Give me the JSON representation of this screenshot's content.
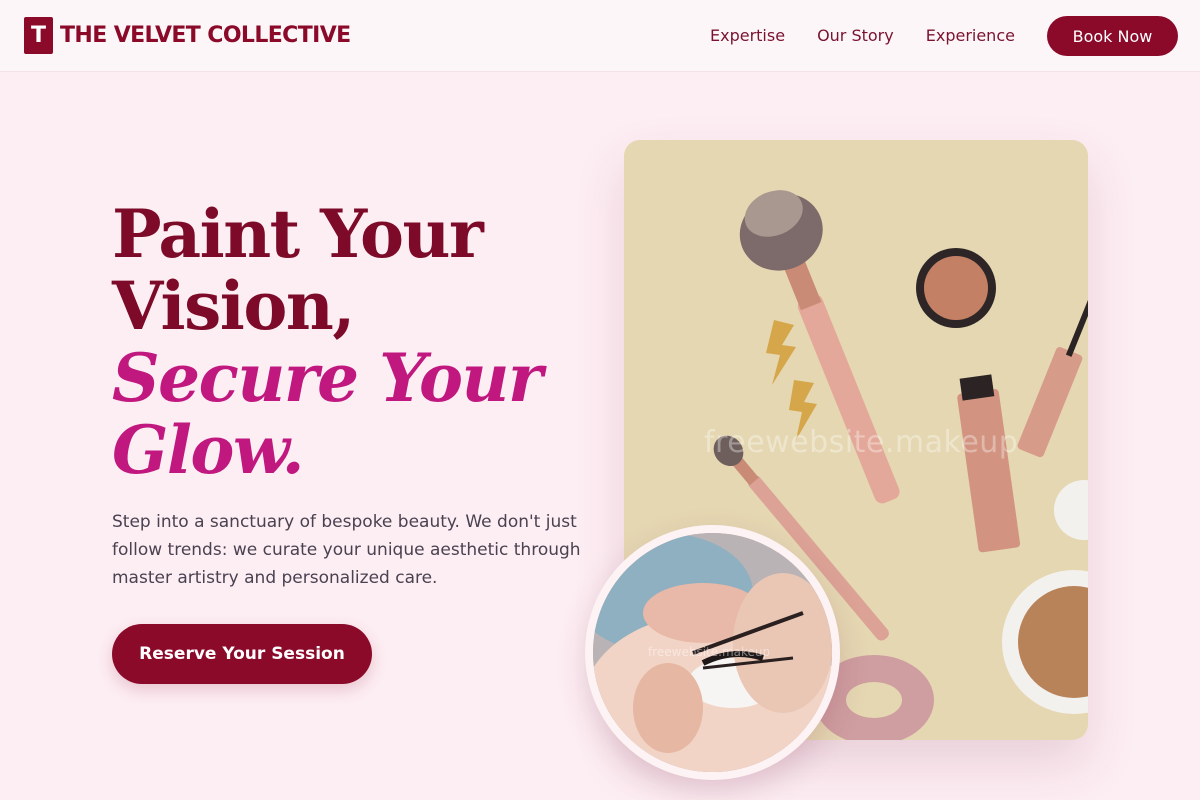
{
  "brand": {
    "logo_letter": "T",
    "name": "THE VELVET COLLECTIVE"
  },
  "nav": {
    "links": [
      "Expertise",
      "Our Story",
      "Experience"
    ],
    "book_label": "Book Now"
  },
  "hero": {
    "line1": "Paint Your",
    "line2": "Vision,",
    "line3": "Secure Your",
    "line4": "Glow.",
    "description": "Step into a sanctuary of bespoke beauty. We don't just follow trends: we curate your unique aesthetic through master artistry and personalized care.",
    "cta_label": "Reserve Your Session"
  },
  "images": {
    "product_watermark": "freewebsite.makeup",
    "lash_watermark": "freewebsite.makeup"
  },
  "colors": {
    "brand": "#8b0a2a",
    "accent": "#c0187f",
    "background": "#fdeef3"
  },
  "icons": {
    "logo": "letter-t-square"
  }
}
